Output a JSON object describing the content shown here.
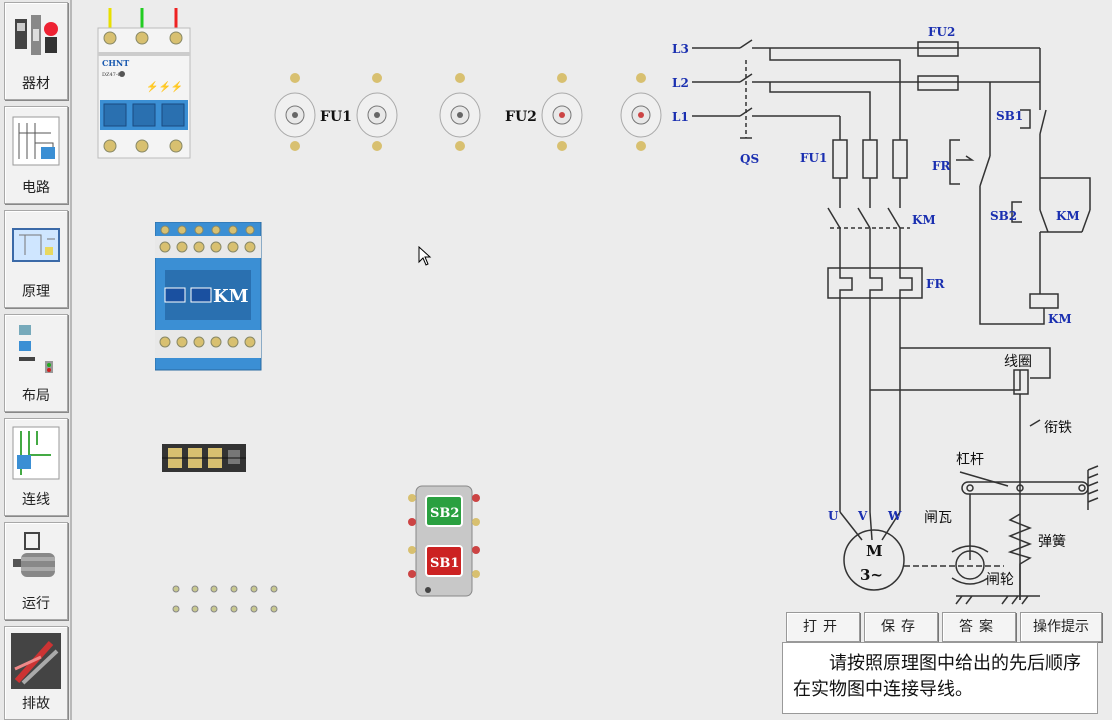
{
  "sidebar": {
    "items": [
      {
        "label": "器材"
      },
      {
        "label": "电路"
      },
      {
        "label": "原理"
      },
      {
        "label": "布局"
      },
      {
        "label": "连线"
      },
      {
        "label": "运行"
      },
      {
        "label": "排故"
      }
    ]
  },
  "workspace": {
    "breaker_brand": "CHNT",
    "breaker_model": "DZ47-60",
    "fuse_group1_label": "FU1",
    "fuse_group2_label": "FU2",
    "contactor_label": "KM",
    "button_top": "SB2",
    "button_bottom": "SB1"
  },
  "schematic": {
    "L1": "L1",
    "L2": "L2",
    "L3": "L3",
    "QS": "QS",
    "FU1": "FU1",
    "FU2": "FU2",
    "KM_main": "KM",
    "FR_main": "FR",
    "FR_nc": "FR",
    "SB1": "SB1",
    "SB2": "SB2",
    "KM_aux": "KM",
    "KM_coil": "KM",
    "U": "U",
    "V": "V",
    "W": "W",
    "motor_M": "M",
    "motor_3": "3~",
    "coil": "线圈",
    "armature": "衔铁",
    "lever": "杠杆",
    "brake_shoe": "闸瓦",
    "spring": "弹簧",
    "brake_wheel": "闸轮"
  },
  "toolbar": {
    "open": "打开",
    "save": "保存",
    "answer": "答案",
    "tips": "操作提示"
  },
  "hint_text": "请按照原理图中给出的先后顺序在实物图中连接导线。",
  "colors": {
    "wire_yellow": "#e8e000",
    "wire_green": "#22cc22",
    "wire_red": "#ee2222",
    "contactor_blue": "#3b8fd4",
    "label_blue": "#1a2fb0"
  }
}
